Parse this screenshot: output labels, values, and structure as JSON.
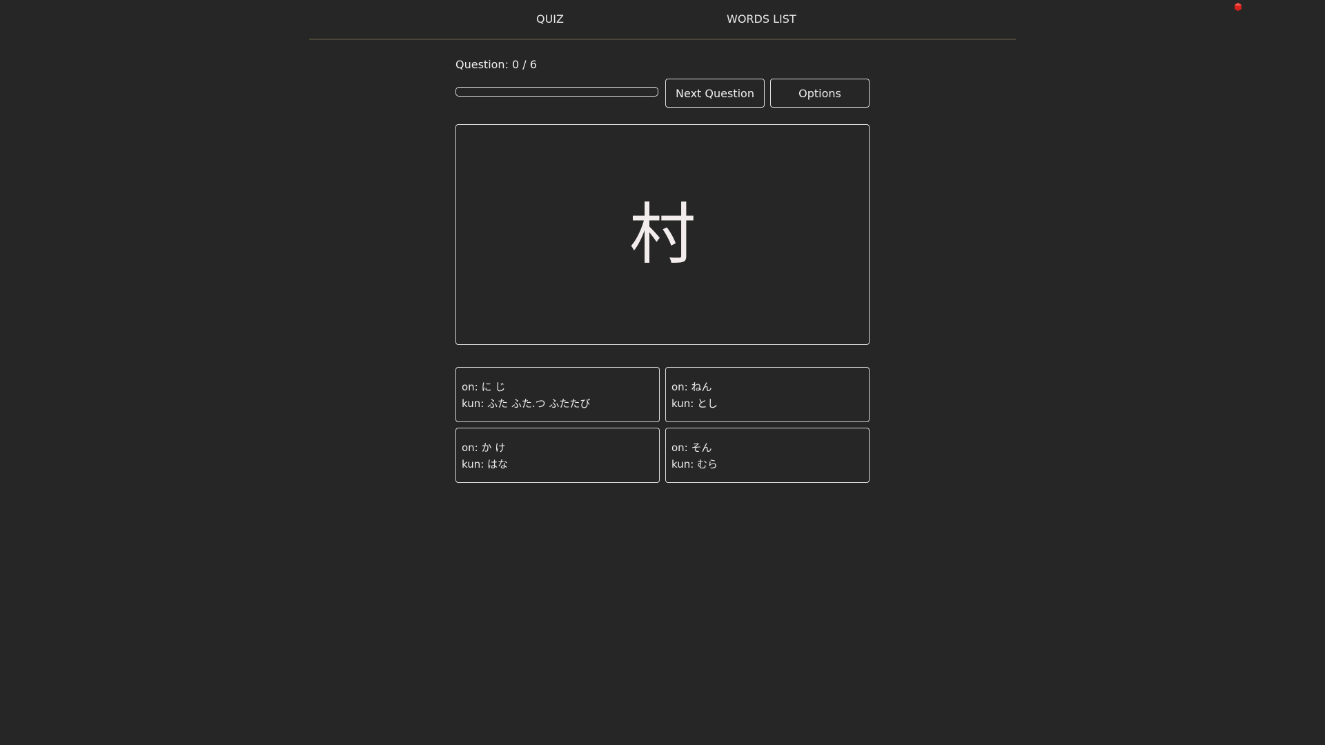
{
  "nav": {
    "items": [
      "QUIZ",
      "WORDS LIST"
    ]
  },
  "corner_icon": {
    "name": "red-gem-icon",
    "color": "#d4211c"
  },
  "quiz": {
    "question_label": "Question: 0 / 6",
    "progress_fraction": 0,
    "next_button": "Next Question",
    "options_button": "Options",
    "kanji": "村",
    "answers": [
      {
        "on": "on: に じ",
        "kun": "kun: ふた ふた.つ ふたたび"
      },
      {
        "on": "on: ねん",
        "kun": "kun: とし"
      },
      {
        "on": "on: か け",
        "kun": "kun: はな"
      },
      {
        "on": "on: そん",
        "kun": "kun: むら"
      }
    ]
  },
  "colors": {
    "background": "#262626",
    "border": "#dcdcdc",
    "nav_divider": "#4a4536"
  }
}
